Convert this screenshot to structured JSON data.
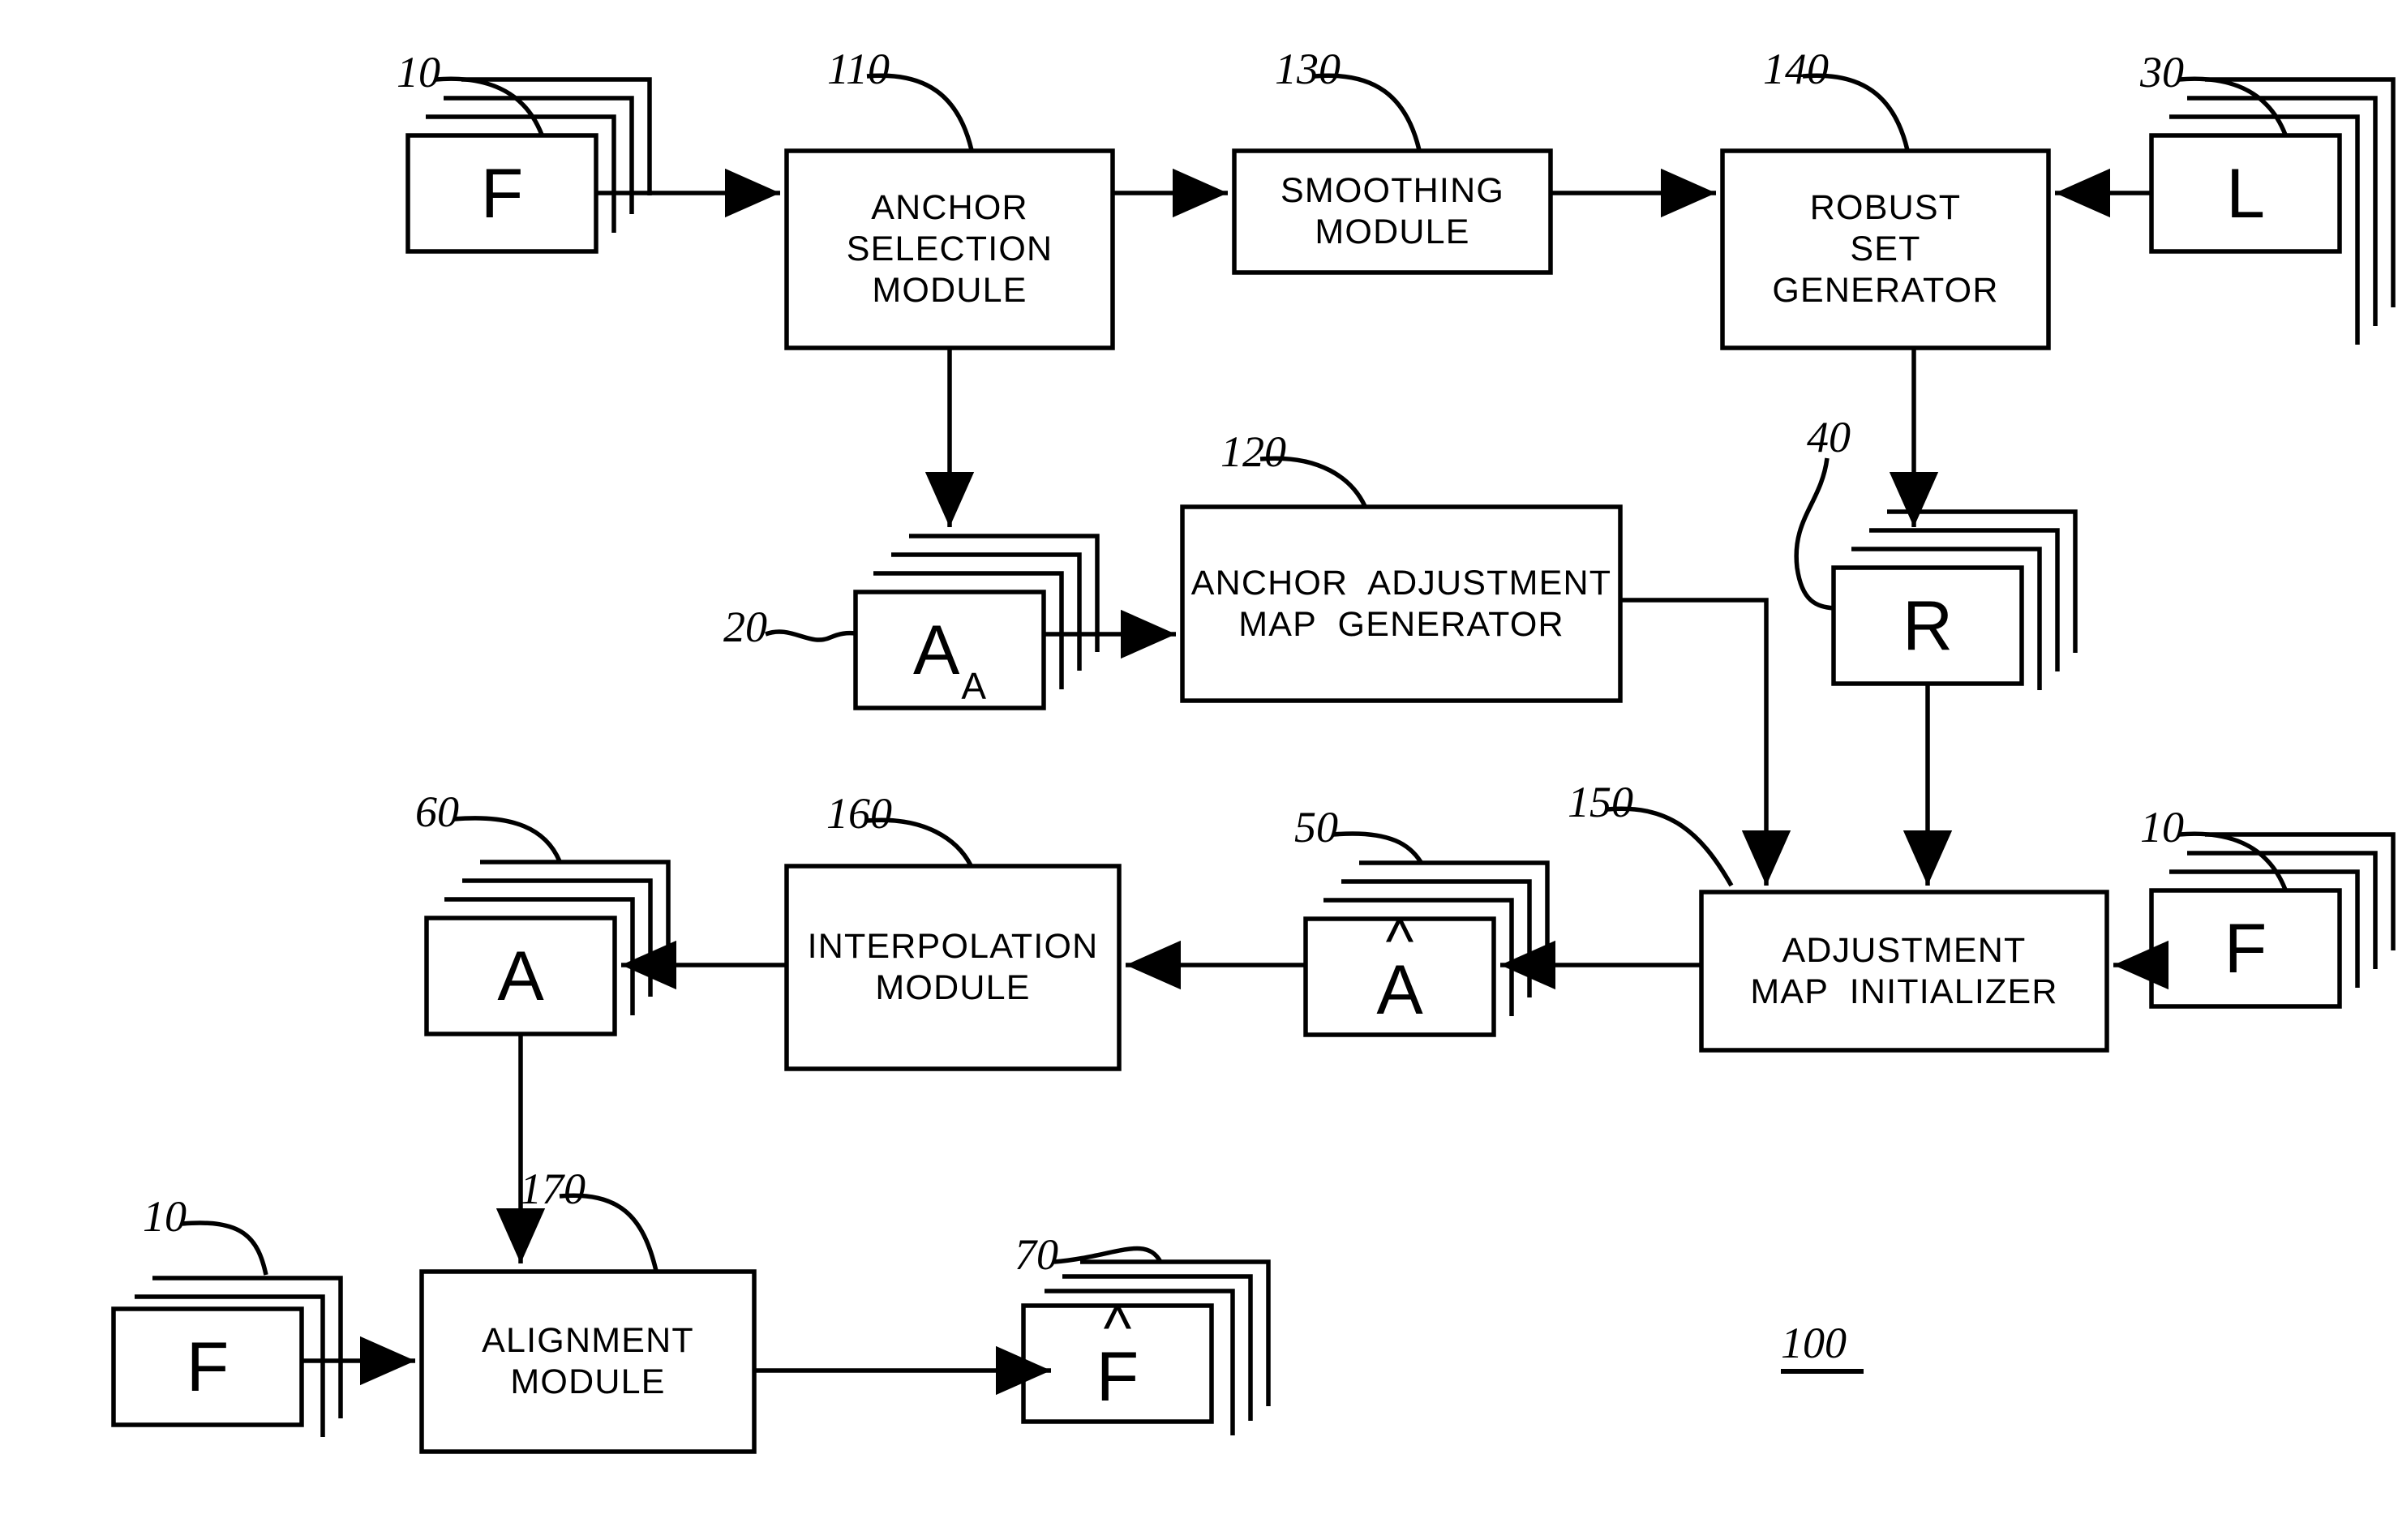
{
  "figure": {
    "label": "100",
    "label_underlined": true
  },
  "modules": [
    {
      "id": "anchor-selection-module",
      "ref": "110",
      "lines": [
        "ANCHOR",
        "SELECTION",
        "MODULE"
      ]
    },
    {
      "id": "smoothing-module",
      "ref": "130",
      "lines": [
        "SMOOTHING",
        "MODULE"
      ]
    },
    {
      "id": "robust-set-generator",
      "ref": "140",
      "lines": [
        "ROBUST",
        "SET",
        "GENERATOR"
      ]
    },
    {
      "id": "anchor-adjustment-map-generator",
      "ref": "120",
      "lines": [
        "ANCHOR  ADJUSTMENT",
        "MAP  GENERATOR"
      ]
    },
    {
      "id": "adjustment-map-initializer",
      "ref": "150",
      "lines": [
        "ADJUSTMENT",
        "MAP  INITIALIZER"
      ]
    },
    {
      "id": "interpolation-module",
      "ref": "160",
      "lines": [
        "INTERPOLATION",
        "MODULE"
      ]
    },
    {
      "id": "alignment-module",
      "ref": "170",
      "lines": [
        "ALIGNMENT",
        "MODULE"
      ]
    }
  ],
  "stacks": [
    {
      "id": "frames-input-top",
      "ref": "10",
      "glyph": "F",
      "sub": "",
      "hat": false,
      "sheets": 4
    },
    {
      "id": "lighting-input",
      "ref": "30",
      "glyph": "L",
      "sub": "",
      "hat": false,
      "sheets": 4
    },
    {
      "id": "anchor-maps",
      "ref": "20",
      "glyph": "A",
      "sub": "A",
      "hat": false,
      "sheets": 4
    },
    {
      "id": "robust-sets",
      "ref": "40",
      "glyph": "R",
      "sub": "",
      "hat": false,
      "sheets": 4
    },
    {
      "id": "adjustment-maps-initial",
      "ref": "50",
      "glyph": "A",
      "sub": "",
      "hat": true,
      "sheets": 4
    },
    {
      "id": "frames-input-right",
      "ref": "10",
      "glyph": "F",
      "sub": "",
      "hat": false,
      "sheets": 4
    },
    {
      "id": "adjustment-maps-final",
      "ref": "60",
      "glyph": "A",
      "sub": "",
      "hat": false,
      "sheets": 4
    },
    {
      "id": "frames-input-bottom",
      "ref": "10",
      "glyph": "F",
      "sub": "",
      "hat": false,
      "sheets": 3
    },
    {
      "id": "frames-output",
      "ref": "70",
      "glyph": "F",
      "sub": "",
      "hat": true,
      "sheets": 4
    }
  ],
  "colors": {
    "ink": "#000000",
    "background": "#ffffff"
  }
}
